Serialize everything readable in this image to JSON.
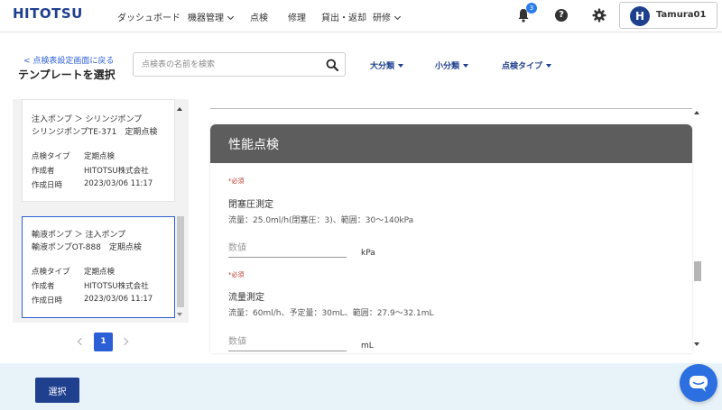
{
  "header": {
    "logo": "HITOTSU",
    "nav": [
      {
        "label": "ダッシュボード",
        "dropdown": false
      },
      {
        "label": "機器管理",
        "dropdown": true
      },
      {
        "label": "点検",
        "dropdown": false
      },
      {
        "label": "修理",
        "dropdown": false
      },
      {
        "label": "貸出・返却",
        "dropdown": false
      },
      {
        "label": "研修",
        "dropdown": true
      }
    ],
    "notification_count": "3",
    "help_glyph": "?",
    "user": {
      "initial": "H",
      "name": "Tamura01"
    }
  },
  "page": {
    "back_link": "< 点検表設定画面に戻る",
    "title": "テンプレートを選択",
    "search": {
      "placeholder": "点検表の名前を検索",
      "value": ""
    },
    "filters": [
      "大分類",
      "小分類",
      "点検タイプ"
    ]
  },
  "templates": [
    {
      "category": "注入ポンプ ＞ シリンジポンプ",
      "name": "シリンジポンプTE-371　定期点検",
      "rows": [
        {
          "label": "点検タイプ",
          "value": "定期点検"
        },
        {
          "label": "作成者",
          "value": "HITOTSU株式会社"
        },
        {
          "label": "作成日時",
          "value": "2023/03/06 11:17"
        }
      ],
      "selected": false
    },
    {
      "category": "輸液ポンプ ＞ 注入ポンプ",
      "name": "輸液ポンプOT-888　定期点検",
      "rows": [
        {
          "label": "点検タイプ",
          "value": "定期点検"
        },
        {
          "label": "作成者",
          "value": "HITOTSU株式会社"
        },
        {
          "label": "作成日時",
          "value": "2023/03/06 11:17"
        }
      ],
      "selected": true
    }
  ],
  "pagination": {
    "current": "1"
  },
  "preview": {
    "section_title": "性能点検",
    "items": [
      {
        "required": "*必須",
        "title": "閉塞圧測定",
        "condition": "流量：25.0ml/h(閉塞圧：3)、範囲：30〜140kPa",
        "placeholder": "数値",
        "unit": "kPa"
      },
      {
        "required": "*必須",
        "title": "流量測定",
        "condition": "流量：60ml/h、予定量：30mL、範囲：27.9〜32.1mL",
        "placeholder": "数値",
        "unit": "mL"
      }
    ]
  },
  "footer": {
    "select_label": "選択"
  },
  "colors": {
    "brand": "#1f3f8f",
    "accent": "#2b5fd6",
    "required": "#c0392b"
  }
}
